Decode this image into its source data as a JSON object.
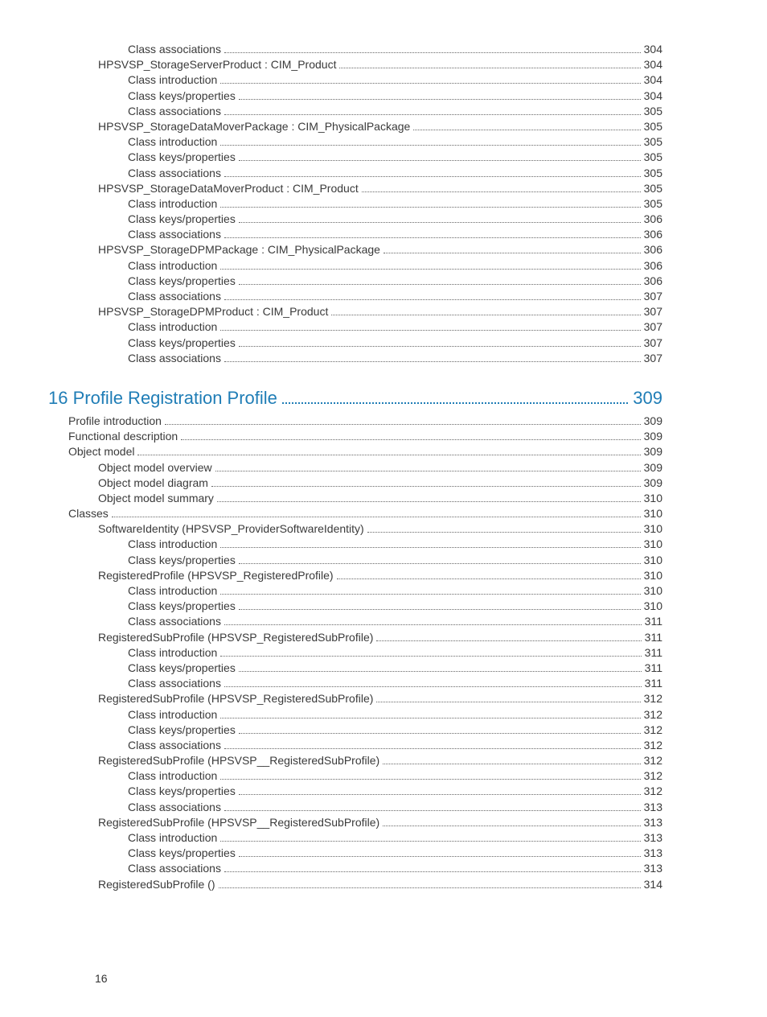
{
  "page_number": "16",
  "top_block": [
    {
      "indent": 3,
      "label": "Class associations",
      "page": "304"
    },
    {
      "indent": 2,
      "label": "HPSVSP_StorageServerProduct : CIM_Product",
      "page": "304"
    },
    {
      "indent": 3,
      "label": "Class introduction",
      "page": "304"
    },
    {
      "indent": 3,
      "label": "Class keys/properties",
      "page": "304"
    },
    {
      "indent": 3,
      "label": "Class associations",
      "page": "305"
    },
    {
      "indent": 2,
      "label": "HPSVSP_StorageDataMoverPackage : CIM_PhysicalPackage",
      "page": "305"
    },
    {
      "indent": 3,
      "label": "Class introduction",
      "page": "305"
    },
    {
      "indent": 3,
      "label": "Class keys/properties",
      "page": "305"
    },
    {
      "indent": 3,
      "label": "Class associations",
      "page": "305"
    },
    {
      "indent": 2,
      "label": "HPSVSP_StorageDataMoverProduct : CIM_Product",
      "page": "305"
    },
    {
      "indent": 3,
      "label": "Class introduction",
      "page": "305"
    },
    {
      "indent": 3,
      "label": "Class keys/properties",
      "page": "306"
    },
    {
      "indent": 3,
      "label": "Class associations",
      "page": "306"
    },
    {
      "indent": 2,
      "label": "HPSVSP_StorageDPMPackage : CIM_PhysicalPackage",
      "page": "306"
    },
    {
      "indent": 3,
      "label": "Class introduction",
      "page": "306"
    },
    {
      "indent": 3,
      "label": "Class keys/properties",
      "page": "306"
    },
    {
      "indent": 3,
      "label": "Class associations",
      "page": "307"
    },
    {
      "indent": 2,
      "label": "HPSVSP_StorageDPMProduct : CIM_Product",
      "page": "307"
    },
    {
      "indent": 3,
      "label": "Class introduction",
      "page": "307"
    },
    {
      "indent": 3,
      "label": "Class keys/properties",
      "page": "307"
    },
    {
      "indent": 3,
      "label": "Class associations",
      "page": "307"
    }
  ],
  "chapter": {
    "label": "16 Profile Registration Profile",
    "page": "309"
  },
  "bottom_block": [
    {
      "indent": 1,
      "label": "Profile introduction",
      "page": "309"
    },
    {
      "indent": 1,
      "label": "Functional description",
      "page": "309"
    },
    {
      "indent": 1,
      "label": "Object model",
      "page": "309"
    },
    {
      "indent": 2,
      "label": "Object model overview",
      "page": "309"
    },
    {
      "indent": 2,
      "label": "Object model diagram",
      "page": "309"
    },
    {
      "indent": 2,
      "label": "Object model summary",
      "page": "310"
    },
    {
      "indent": 1,
      "label": "Classes",
      "page": "310"
    },
    {
      "indent": 2,
      "label": "SoftwareIdentity (HPSVSP_ProviderSoftwareIdentity)",
      "page": "310"
    },
    {
      "indent": 3,
      "label": "Class introduction",
      "page": "310"
    },
    {
      "indent": 3,
      "label": "Class keys/properties",
      "page": "310"
    },
    {
      "indent": 2,
      "label": "RegisteredProfile (HPSVSP_RegisteredProfile)",
      "page": "310"
    },
    {
      "indent": 3,
      "label": "Class introduction",
      "page": "310"
    },
    {
      "indent": 3,
      "label": "Class keys/properties",
      "page": "310"
    },
    {
      "indent": 3,
      "label": "Class associations",
      "page": "311"
    },
    {
      "indent": 2,
      "label": "RegisteredSubProfile (HPSVSP_RegisteredSubProfile)",
      "page": "311"
    },
    {
      "indent": 3,
      "label": "Class introduction",
      "page": "311"
    },
    {
      "indent": 3,
      "label": "Class keys/properties",
      "page": "311"
    },
    {
      "indent": 3,
      "label": "Class associations",
      "page": "311"
    },
    {
      "indent": 2,
      "label": "RegisteredSubProfile (HPSVSP_RegisteredSubProfile)",
      "page": "312"
    },
    {
      "indent": 3,
      "label": "Class introduction",
      "page": "312"
    },
    {
      "indent": 3,
      "label": "Class keys/properties",
      "page": "312"
    },
    {
      "indent": 3,
      "label": "Class associations",
      "page": "312"
    },
    {
      "indent": 2,
      "label": "RegisteredSubProfile (HPSVSP__RegisteredSubProfile)",
      "page": "312"
    },
    {
      "indent": 3,
      "label": "Class introduction",
      "page": "312"
    },
    {
      "indent": 3,
      "label": "Class keys/properties",
      "page": "312"
    },
    {
      "indent": 3,
      "label": "Class associations",
      "page": "313"
    },
    {
      "indent": 2,
      "label": "RegisteredSubProfile (HPSVSP__RegisteredSubProfile)",
      "page": "313"
    },
    {
      "indent": 3,
      "label": "Class introduction",
      "page": "313"
    },
    {
      "indent": 3,
      "label": "Class keys/properties",
      "page": "313"
    },
    {
      "indent": 3,
      "label": "Class associations",
      "page": "313"
    },
    {
      "indent": 2,
      "label": "RegisteredSubProfile ()",
      "page": "314"
    }
  ]
}
